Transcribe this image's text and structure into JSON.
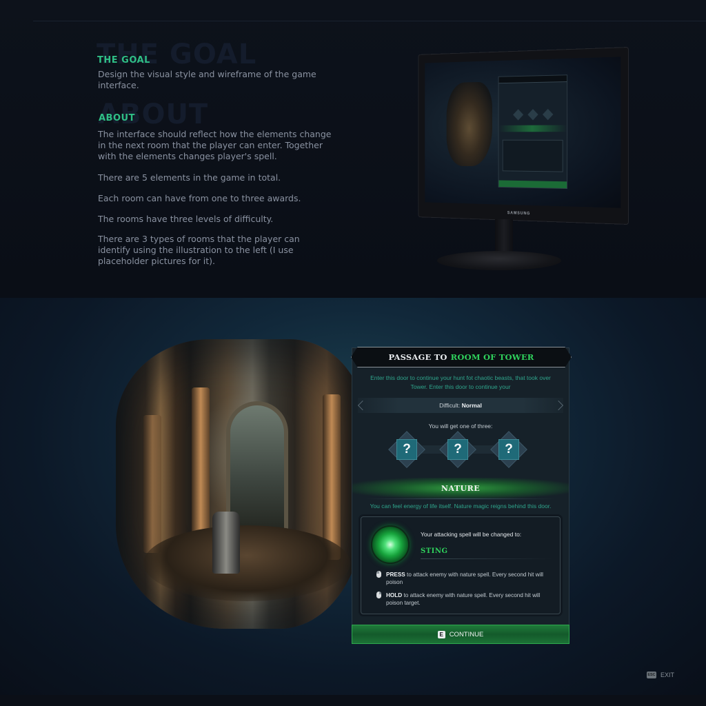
{
  "intro": {
    "goal": {
      "ghost": "THE GOAL",
      "heading": "THE GOAL",
      "text": "Design the visual style and wireframe of the game interface."
    },
    "about": {
      "ghost": "ABOUT",
      "heading": "ABOUT",
      "paragraphs": [
        "The interface should reflect how the elements change in the next room that the player can enter. Together with the elements changes player's spell.",
        "There are 5 elements in the game in total.",
        "Each room can have from one to three awards.",
        "The rooms have three levels of difficulty.",
        "There are 3 types of rooms that the player can identify using the illustration to the left (I use placeholder pictures for it)."
      ]
    },
    "monitor": {
      "brand": "SAMSUNG"
    }
  },
  "panel": {
    "title_prefix": "PASSAGE TO",
    "title_room": "ROOM OF TOWER",
    "description": "Enter this door to continue your hunt fot chaotic beasts, that took over Tower. Enter this door to continue your",
    "difficulty_label": "Difficult:",
    "difficulty_value": "Normal",
    "rewards_label": "You will get one of three:",
    "rewards": [
      "?",
      "?",
      "?"
    ],
    "element": "NATURE",
    "element_description": "You can feel energy of life itself. Nature magic reigns behind this door.",
    "spell": {
      "heading": "Your attacking spell will be changed to:",
      "name": "STING",
      "controls": [
        {
          "action": "PRESS",
          "text": " to attack enemy with nature spell. Every second hit will poison"
        },
        {
          "action": "HOLD",
          "text": " to attack enemy with nature spell. Every second hit will poison target."
        }
      ]
    },
    "continue": {
      "key": "E",
      "label": "CONTINUE"
    }
  },
  "exit": {
    "key": "ESC",
    "label": "EXIT"
  },
  "colors": {
    "accent_green": "#2fd15c",
    "teal_text": "#2fa58c",
    "heading_green": "#2fbf86"
  },
  "icons": {
    "spell": "nature-spell-icon",
    "left_click": "mouse-left-icon",
    "right_click": "mouse-right-icon"
  }
}
